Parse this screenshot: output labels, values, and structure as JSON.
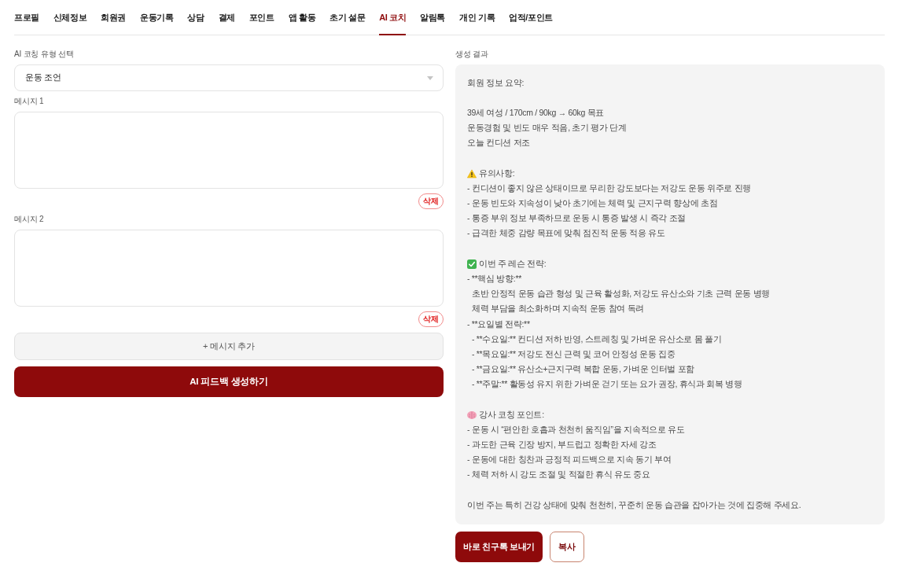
{
  "tabs": [
    {
      "label": "프로필",
      "selected": false
    },
    {
      "label": "신체정보",
      "selected": false
    },
    {
      "label": "회원권",
      "selected": false
    },
    {
      "label": "운동기록",
      "selected": false
    },
    {
      "label": "상담",
      "selected": false
    },
    {
      "label": "결제",
      "selected": false
    },
    {
      "label": "포인트",
      "selected": false
    },
    {
      "label": "앱 활동",
      "selected": false
    },
    {
      "label": "초기 설문",
      "selected": false
    },
    {
      "label": "AI 코치",
      "selected": true
    },
    {
      "label": "알림톡",
      "selected": false
    },
    {
      "label": "개인 기록",
      "selected": false
    },
    {
      "label": "업적/포인트",
      "selected": false
    }
  ],
  "coaching_type": {
    "label": "AI 코칭 유형 선택",
    "value": "운동 조언"
  },
  "messages": [
    {
      "label": "메시지 1",
      "delete_button": "삭제"
    },
    {
      "label": "메시지 2",
      "delete_button": "삭제"
    }
  ],
  "add_message_button": "+ 메시지 추가",
  "generate_button": "AI 피드백 생성하기",
  "result": {
    "label": "생성 결과",
    "sections": [
      {
        "lines": [
          {
            "text": "회원 정보 요약:"
          }
        ]
      },
      {
        "lines": [
          {
            "text": "39세 여성 / 170cm / 90kg → 60kg 목표"
          },
          {
            "text": "운동경험 및 빈도 매우 적음, 초기 평가 단계"
          },
          {
            "text": "오늘 컨디션 저조"
          }
        ]
      },
      {
        "lines": [
          {
            "text": "유의사항:"
          },
          {
            "text": "- 컨디션이 좋지 않은 상태이므로 무리한 강도보다는 저강도 운동 위주로 진행"
          },
          {
            "text": "- 운동 빈도와 지속성이 낮아 초기에는 체력 및 근지구력 향상에 초점"
          },
          {
            "text": "- 통증 부위 정보 부족하므로 운동 시 통증 발생 시 즉각 조절"
          },
          {
            "text": "- 급격한 체중 감량 목표에 맞춰 점진적 운동 적응 유도"
          }
        ]
      },
      {
        "lines": [
          {
            "text": "이번 주 레슨 전략:"
          },
          {
            "text": "- **핵심 방향:**",
            "children": [
              {
                "text": "초반 안정적 운동 습관 형성 및 근육 활성화, 저강도 유산소와 기초 근력 운동 병행"
              },
              {
                "text": "체력 부담을 최소화하며 지속적 운동 참여 독려"
              }
            ]
          },
          {
            "text": "- **요일별 전략:**",
            "children": [
              {
                "text": "- **수요일:** 컨디션 저하 반영, 스트레칭 및 가벼운 유산소로 몸 풀기"
              },
              {
                "text": "- **목요일:** 저강도 전신 근력 및 코어 안정성 운동 집중"
              },
              {
                "text": "- **금요일:** 유산소+근지구력 복합 운동, 가벼운 인터벌 포함"
              },
              {
                "text": "- **주말:** 활동성 유지 위한 가벼운 걷기 또는 요가 권장, 휴식과 회복 병행"
              }
            ]
          }
        ]
      },
      {
        "lines": [
          {
            "text": "강사 코칭 포인트:"
          },
          {
            "text": "- 운동 시 “편안한 호흡과 천천히 움직임”을 지속적으로 유도"
          },
          {
            "text": "- 과도한 근육 긴장 방지, 부드럽고 정확한 자세 강조"
          },
          {
            "text": "- 운동에 대한 칭찬과 긍정적 피드백으로 지속 동기 부여"
          },
          {
            "text": "- 체력 저하 시 강도 조절 및 적절한 휴식 유도 중요"
          }
        ]
      },
      {
        "lines": [
          {
            "text": "이번 주는 특히 건강 상태에 맞춰 천천히, 꾸준히 운동 습관을 잡아가는 것에 집중해 주세요."
          }
        ]
      }
    ]
  },
  "actions": [
    {
      "label": "바로 친구톡 보내기",
      "kind": "primary"
    },
    {
      "label": "복사",
      "kind": "outline"
    }
  ]
}
